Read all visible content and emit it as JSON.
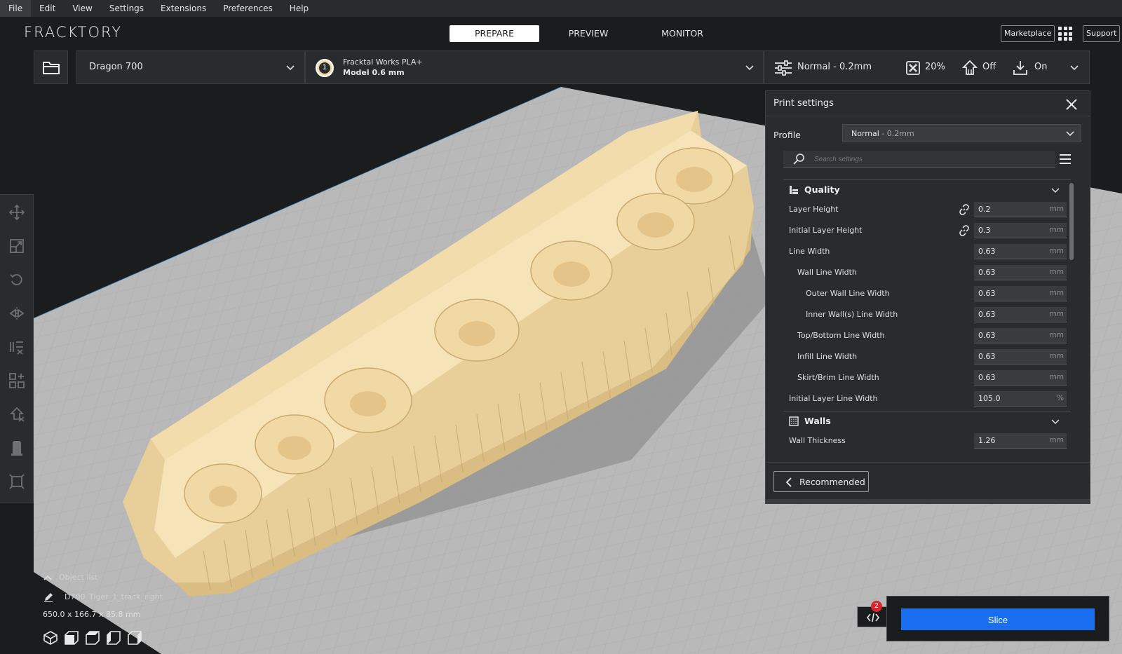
{
  "menu": {
    "items": [
      {
        "label": "File"
      },
      {
        "label": "Edit"
      },
      {
        "label": "View"
      },
      {
        "label": "Settings"
      },
      {
        "label": "Extensions"
      },
      {
        "label": "Preferences"
      },
      {
        "label": "Help"
      }
    ]
  },
  "header": {
    "logo": "FRACKTORY",
    "stages": [
      {
        "label": "PREPARE",
        "active": true
      },
      {
        "label": "PREVIEW",
        "active": false
      },
      {
        "label": "MONITOR",
        "active": false
      }
    ],
    "marketplace_label": "Marketplace",
    "support_label": "Support"
  },
  "toolbar": {
    "open_icon": "folder-icon",
    "printer": "Dragon 700",
    "extruder_number": "1",
    "material": "Fracktal Works PLA+",
    "nozzle": "Model 0.6 mm",
    "profile_summary": "Normal - 0.2mm",
    "infill": "20%",
    "support": "Off",
    "adhesion": "On"
  },
  "print_settings": {
    "title": "Print settings",
    "profile_label": "Profile",
    "profile_name": "Normal",
    "profile_suffix": " - 0.2mm",
    "search_placeholder": "Search settings",
    "categories": [
      {
        "name": "Quality",
        "settings": [
          {
            "label": "Layer Height",
            "value": "0.2",
            "unit": "mm",
            "linked": true
          },
          {
            "label": "Initial Layer Height",
            "value": "0.3",
            "unit": "mm",
            "linked": true
          },
          {
            "label": "Line Width",
            "value": "0.63",
            "unit": "mm"
          },
          {
            "label": "Wall Line Width",
            "value": "0.63",
            "unit": "mm"
          },
          {
            "label": "Outer Wall Line Width",
            "value": "0.63",
            "unit": "mm"
          },
          {
            "label": "Inner Wall(s) Line Width",
            "value": "0.63",
            "unit": "mm"
          },
          {
            "label": "Top/Bottom Line Width",
            "value": "0.63",
            "unit": "mm"
          },
          {
            "label": "Infill Line Width",
            "value": "0.63",
            "unit": "mm"
          },
          {
            "label": "Skirt/Brim Line Width",
            "value": "0.63",
            "unit": "mm"
          },
          {
            "label": "Initial Layer Line Width",
            "value": "105.0",
            "unit": "%"
          }
        ]
      },
      {
        "name": "Walls",
        "settings": [
          {
            "label": "Wall Thickness",
            "value": "1.26",
            "unit": "mm"
          }
        ]
      }
    ],
    "recommended_label": "Recommended"
  },
  "object_list": {
    "header": "Object list",
    "object_name": "D700_Tiger_1_track_right",
    "dimensions": "650.0 x 166.7 x 85.8 mm"
  },
  "slice": {
    "label": "Slice",
    "log_badge": "2"
  },
  "colors": {
    "accent": "#196ef0",
    "model": "#f0d9a8",
    "bed": "#b9b9b9",
    "background": "#1b1c1e",
    "panel": "#2a2b2d"
  }
}
